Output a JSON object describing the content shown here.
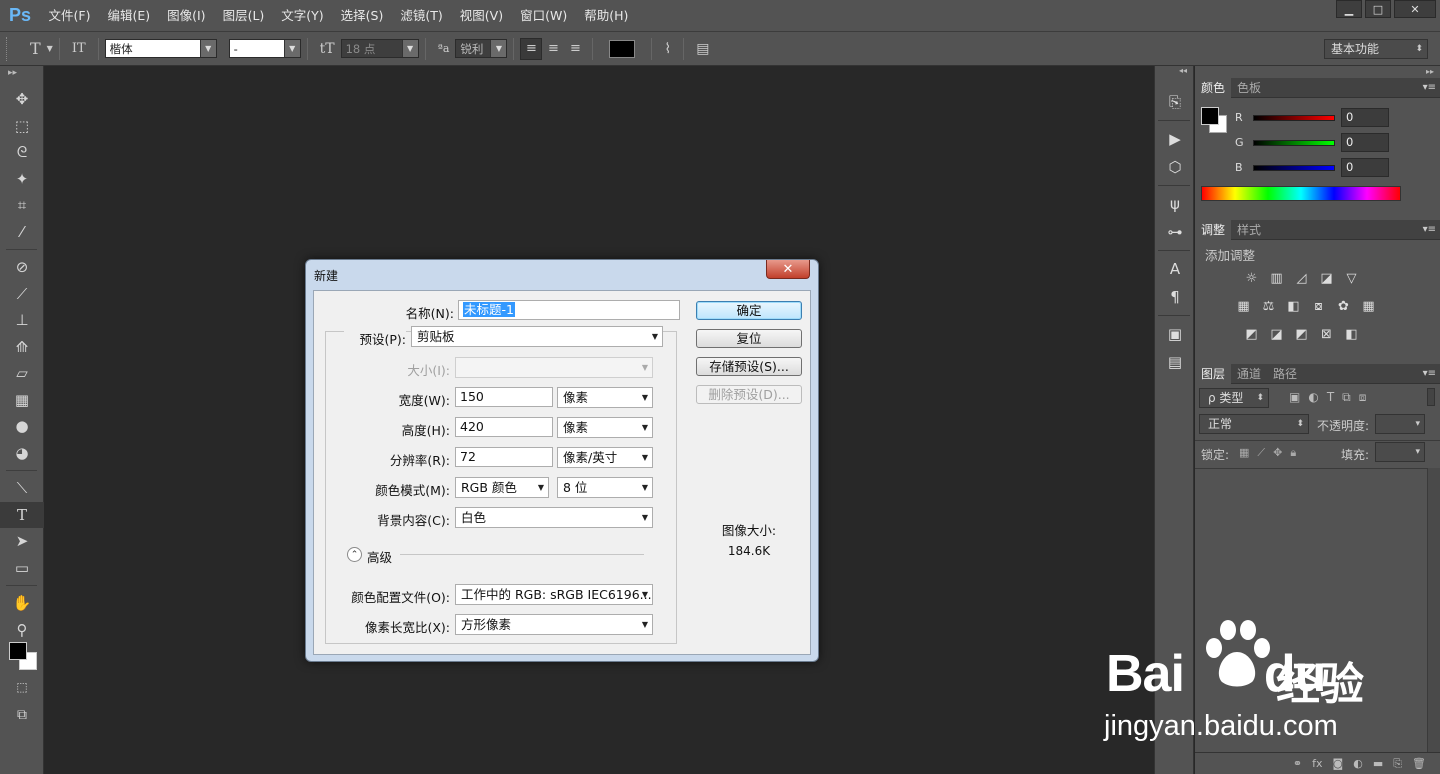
{
  "menubar": {
    "logo": "Ps",
    "items": [
      "文件(F)",
      "编辑(E)",
      "图像(I)",
      "图层(L)",
      "文字(Y)",
      "选择(S)",
      "滤镜(T)",
      "视图(V)",
      "窗口(W)",
      "帮助(H)"
    ],
    "window_controls": {
      "minimize": "▁",
      "maximize": "□",
      "close": "✕"
    }
  },
  "optionsbar": {
    "tool_icon": "T",
    "font_family": "楷体",
    "font_style": "-",
    "font_size": "18 点",
    "aa_label": "ªa",
    "anti_alias": "锐利",
    "workspace": "基本功能"
  },
  "colors": {
    "fg": "#000000",
    "bg": "#ffffff",
    "accent": "#3399ff"
  },
  "color_panel": {
    "tabs": [
      "颜色",
      "色板"
    ],
    "r_label": "R",
    "g_label": "G",
    "b_label": "B",
    "r": "0",
    "g": "0",
    "b": "0"
  },
  "adjust_panel": {
    "tabs": [
      "调整",
      "样式"
    ],
    "title": "添加调整"
  },
  "layers_panel": {
    "tabs": [
      "图层",
      "通道",
      "路径"
    ],
    "filter": "ρ 类型",
    "blend_mode": "正常",
    "opacity_label": "不透明度:",
    "lock_label": "锁定:",
    "fill_label": "填充:"
  },
  "dialog": {
    "title": "新建",
    "close": "✕",
    "name_label": "名称(N):",
    "name_value": "未标题-1",
    "preset_label": "预设(P):",
    "preset_value": "剪贴板",
    "size_label": "大小(I):",
    "width_label": "宽度(W):",
    "width_value": "150",
    "width_unit": "像素",
    "height_label": "高度(H):",
    "height_value": "420",
    "height_unit": "像素",
    "resolution_label": "分辨率(R):",
    "resolution_value": "72",
    "resolution_unit": "像素/英寸",
    "color_mode_label": "颜色模式(M):",
    "color_mode_value": "RGB 颜色",
    "bit_depth": "8 位",
    "background_label": "背景内容(C):",
    "background_value": "白色",
    "advanced_label": "高级",
    "profile_label": "颜色配置文件(O):",
    "profile_value": "工作中的 RGB: sRGB IEC6196...",
    "aspect_label": "像素长宽比(X):",
    "aspect_value": "方形像素",
    "ok": "确定",
    "reset": "复位",
    "save_preset": "存储预设(S)...",
    "delete_preset": "删除预设(D)...",
    "image_size_label": "图像大小:",
    "image_size_value": "184.6K"
  },
  "watermark": {
    "brand": "Bai",
    "brand_suffix": "du",
    "brand_cn": "经验",
    "url": "jingyan.baidu.com"
  }
}
